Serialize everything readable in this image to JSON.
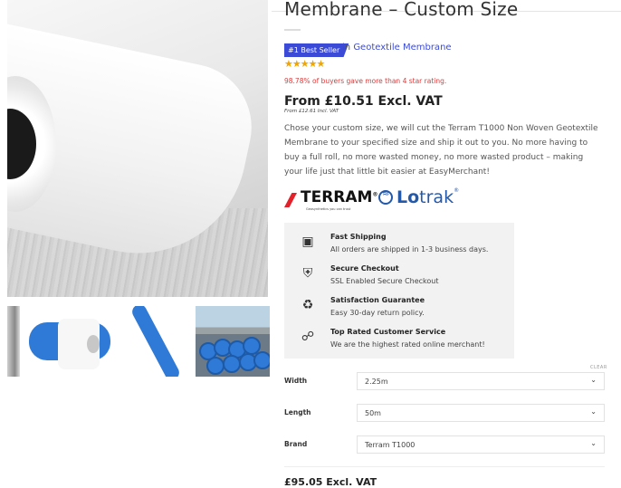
{
  "product": {
    "title": "Membrane – Custom Size",
    "badge": "#1 Best Seller",
    "category_prefix": "in",
    "category": "Geotextile Membrane",
    "stars": "★★★★★",
    "rating_note": "98.78% of buyers gave more than 4 star rating.",
    "price_main": "From £10.51 Excl. VAT",
    "price_incl": "From £12.61 Incl. VAT",
    "description": "Chose your custom size, we will cut the Terram T1000 Non Woven Geotextile Membrane to your specified size and ship it out to you. No more having to buy a full roll, no more wasted money, no more wasted product – making your life just that little bit easier at EasyMerchant!"
  },
  "brands": {
    "terram": "TERRAM",
    "terram_reg": "®",
    "terram_tagline": "Geosynthetics you can trust",
    "lotrak_bold": "Lo",
    "lotrak_rest": "trak",
    "lotrak_reg": "®"
  },
  "features": [
    {
      "icon": "truck-icon",
      "title": "Fast Shipping",
      "subtitle": "All orders are shipped in 1-3 business days."
    },
    {
      "icon": "shield-icon",
      "title": "Secure Checkout",
      "subtitle": "SSL Enabled Secure Checkout"
    },
    {
      "icon": "recycle-icon",
      "title": "Satisfaction Guarantee",
      "subtitle": "Easy 30-day return policy."
    },
    {
      "icon": "handshake-icon",
      "title": "Top Rated Customer Service",
      "subtitle": "We are the highest rated online merchant!"
    }
  ],
  "options": {
    "clear_label": "CLEAR",
    "width": {
      "label": "Width",
      "value": "2.25m"
    },
    "length": {
      "label": "Length",
      "value": "50m"
    },
    "brand": {
      "label": "Brand",
      "value": "Terram T1000"
    }
  },
  "final_price": "£95.05 Excl. VAT",
  "colors": {
    "accent": "#3b4bd8",
    "rating": "#f0a500",
    "alert": "#e03a3a",
    "terram_red": "#e3212a",
    "lotrak_blue": "#2458a8"
  }
}
